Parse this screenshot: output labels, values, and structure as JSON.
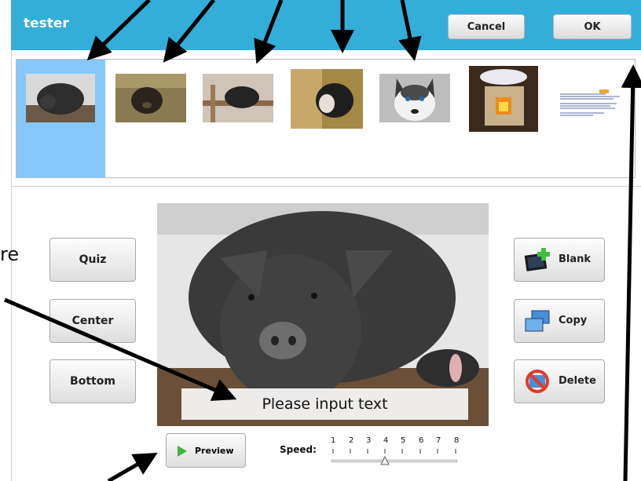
{
  "header": {
    "title": "tester",
    "cancel_label": "Cancel",
    "ok_label": "OK",
    "color": "#33aed9"
  },
  "thumbnails": [
    "pig-1",
    "pig-2",
    "pig-3",
    "pig-4",
    "husky-dog",
    "stove",
    "document-page"
  ],
  "left_text": "re",
  "layout_buttons": {
    "quiz": "Quiz",
    "center": "Center",
    "bottom": "Bottom"
  },
  "actions": {
    "blank": "Blank",
    "copy": "Copy",
    "delete": "Delete"
  },
  "caption": {
    "text": "Please input text"
  },
  "preview": {
    "label": "Preview"
  },
  "speed": {
    "label": "Speed:",
    "ticks": [
      "1",
      "2",
      "3",
      "4",
      "5",
      "6",
      "7",
      "8"
    ],
    "value": 4
  },
  "colors": {
    "selected_bg": "#86c8f8",
    "accent": "#33aed9"
  }
}
